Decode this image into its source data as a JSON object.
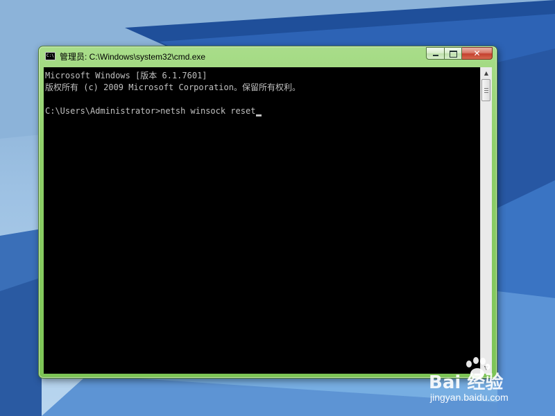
{
  "window": {
    "title": "管理员: C:\\Windows\\system32\\cmd.exe",
    "icon_text": "C:\\",
    "buttons": {
      "minimize": "minimize",
      "maximize": "maximize",
      "close": "✕"
    }
  },
  "console": {
    "lines": [
      "Microsoft Windows [版本 6.1.7601]",
      "版权所有 (c) 2009 Microsoft Corporation。保留所有权利。",
      "",
      "C:\\Users\\Administrator>netsh winsock reset"
    ]
  },
  "scrollbar": {
    "up_arrow": "▲",
    "down_arrow": "▼"
  },
  "watermark": {
    "brand": "Bai 经验",
    "url": "jingyan.baidu.com"
  },
  "colors": {
    "console_bg": "#000000",
    "console_text": "#c0c0c0",
    "frame": "#8fcf6a",
    "close_button": "#c4402e"
  },
  "icons": [
    "cmd-icon",
    "minimize-icon",
    "maximize-icon",
    "close-icon",
    "scroll-up-icon",
    "scroll-down-icon",
    "paw-icon"
  ]
}
